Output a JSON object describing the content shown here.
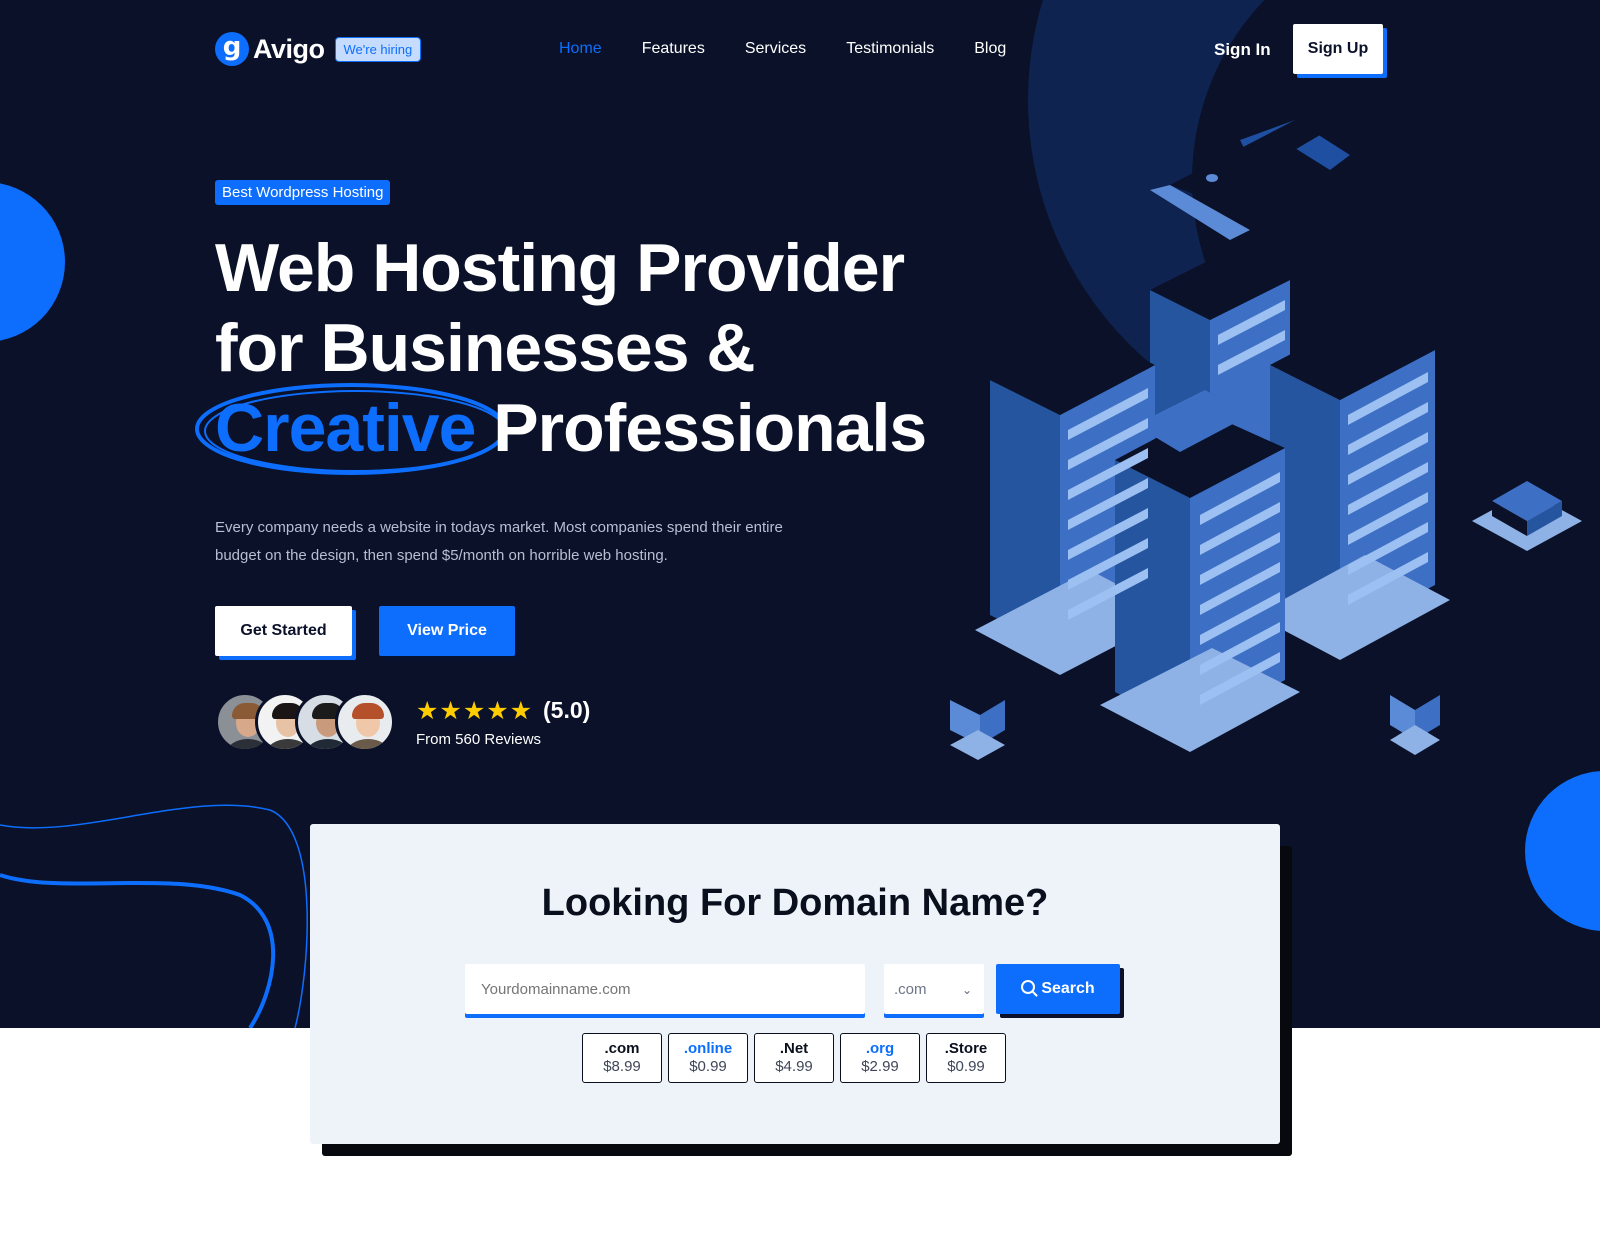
{
  "brand": {
    "logo_letter": "g",
    "name": "Avigo",
    "hiring_badge": "We're hiring"
  },
  "nav": {
    "items": [
      {
        "label": "Home",
        "active": true
      },
      {
        "label": "Features",
        "active": false
      },
      {
        "label": "Services",
        "active": false
      },
      {
        "label": "Testimonials",
        "active": false
      },
      {
        "label": "Blog",
        "active": false
      }
    ],
    "sign_in": "Sign In",
    "sign_up": "Sign Up"
  },
  "hero": {
    "badge": "Best Wordpress Hosting",
    "headline_line1": "Web Hosting Provider",
    "headline_line2": "for Businesses &",
    "headline_highlight": "Creative",
    "headline_line3_rest": "Professionals",
    "subtitle": "Every company needs a website in todays market. Most companies spend their entire budget on the design, then spend $5/month on horrible web hosting.",
    "cta_primary": "Get Started",
    "cta_secondary": "View Price",
    "stars": "★★★★★",
    "rating": "(5.0)",
    "rating_value": 5.0,
    "reviews": "From 560 Reviews"
  },
  "domain": {
    "title": "Looking For Domain Name?",
    "input_placeholder": "Yourdomainname.com",
    "tld_selected": ".com",
    "search_label": "Search",
    "tlds": [
      {
        "name": ".com",
        "price": "$8.99",
        "highlight": false
      },
      {
        "name": ".online",
        "price": "$0.99",
        "highlight": true
      },
      {
        "name": ".Net",
        "price": "$4.99",
        "highlight": false
      },
      {
        "name": ".org",
        "price": "$2.99",
        "highlight": true
      },
      {
        "name": ".Store",
        "price": "$0.99",
        "highlight": false
      }
    ]
  },
  "colors": {
    "background": "#0a1128",
    "accent": "#0d6efd",
    "card": "#eef3fa",
    "star": "#ffcc00"
  },
  "icons": [
    "logo-icon",
    "star-icon",
    "search-icon",
    "chevron-down-icon",
    "server-illustration"
  ]
}
